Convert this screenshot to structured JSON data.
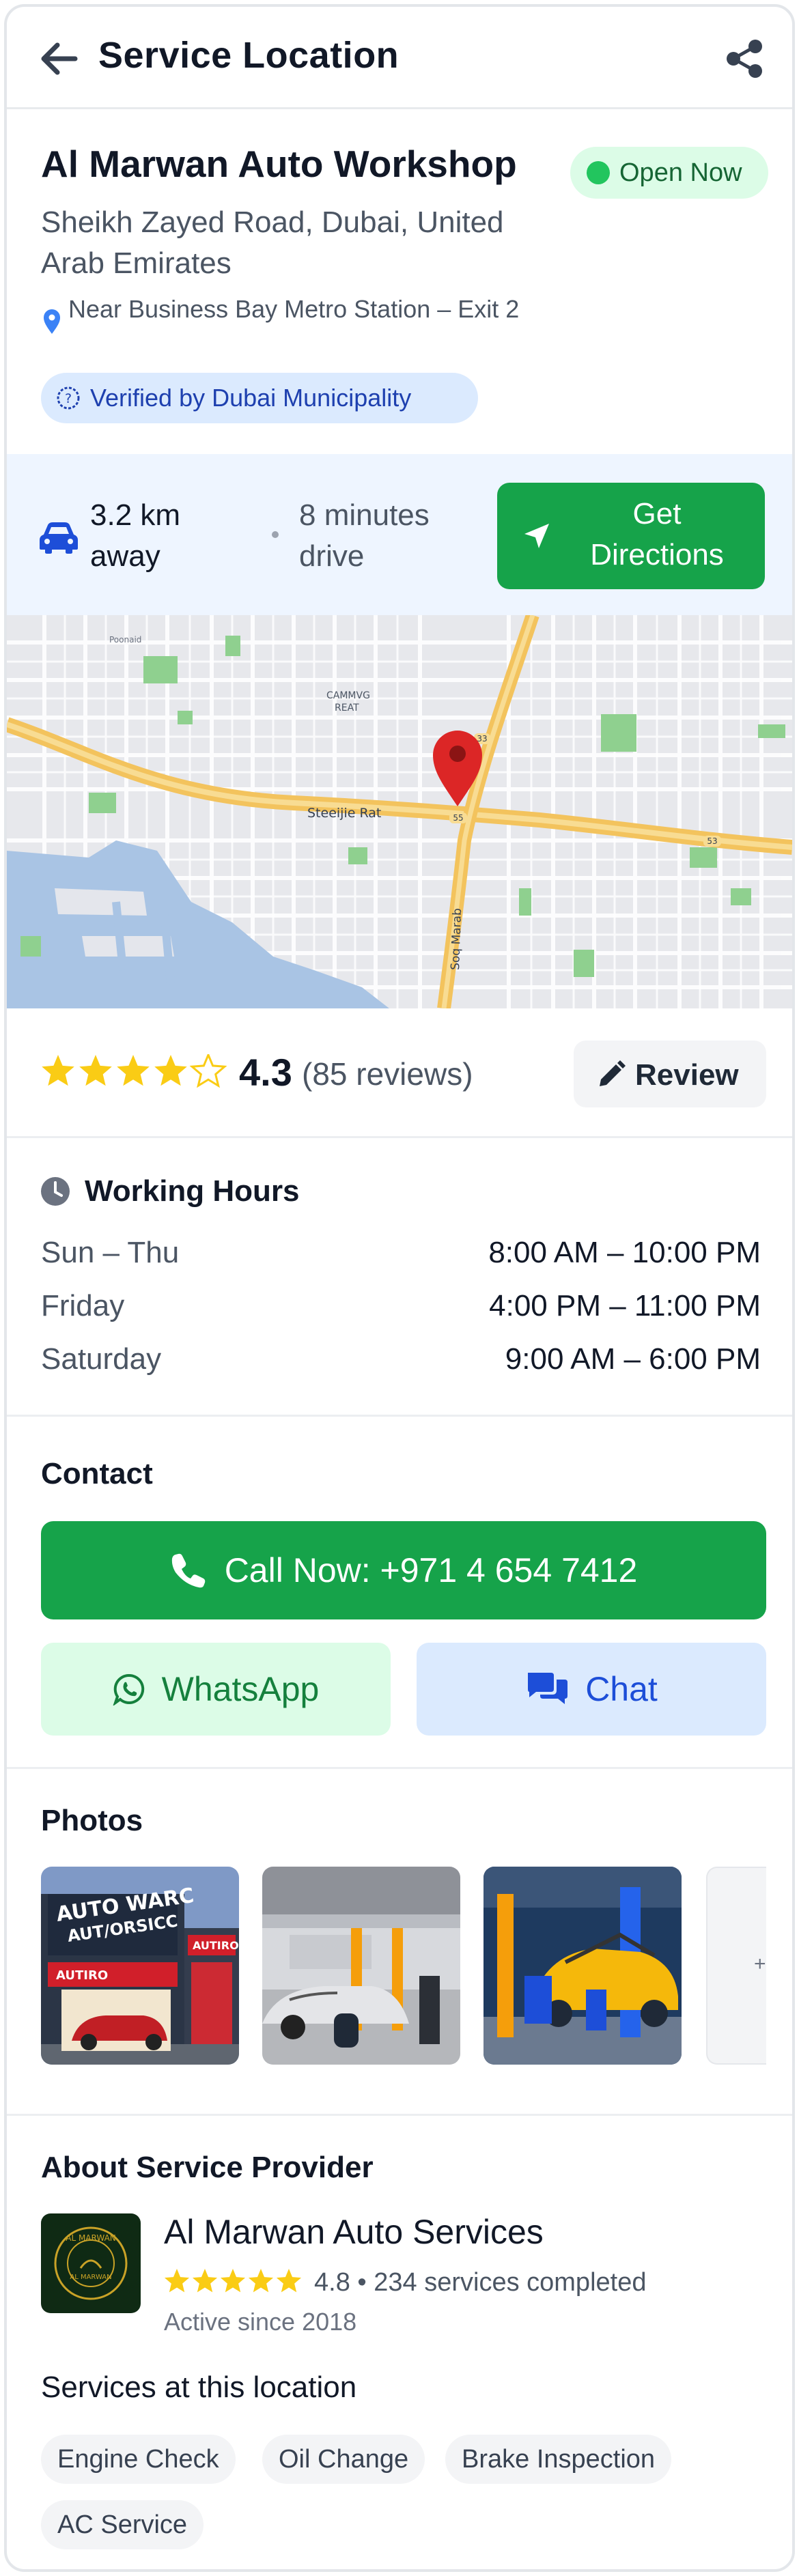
{
  "header": {
    "title": "Service Location"
  },
  "business": {
    "name": "Al Marwan Auto Workshop",
    "status": "Open Now",
    "address": "Sheikh Zayed Road, Dubai, United Arab Emirates",
    "landmark": "Near Business Bay Metro Station – Exit 2",
    "verified": "Verified by Dubai Municipality"
  },
  "distance": {
    "distance": "3.2 km away",
    "drive_time": "8 minutes drive",
    "directions_label": "Get Directions"
  },
  "map": {
    "road_label_1": "Steeijie Rat",
    "road_label_2": "Soq Marab",
    "area_label_1": "CAMMVG",
    "area_label_2": "REAT",
    "area_label_3": "Poonaid",
    "route_1": "55",
    "route_2": "33",
    "route_3": "53"
  },
  "rating": {
    "value": "4.3",
    "reviews": "(85 reviews)",
    "stars": 4.3,
    "review_button": "Review"
  },
  "hours": {
    "title": "Working Hours",
    "rows": [
      {
        "day": "Sun – Thu",
        "time": "8:00 AM – 10:00 PM"
      },
      {
        "day": "Friday",
        "time": "4:00 PM – 11:00 PM"
      },
      {
        "day": "Saturday",
        "time": "9:00 AM – 6:00 PM"
      }
    ]
  },
  "contact": {
    "title": "Contact",
    "call_label": "Call Now: +971 4 654 7412",
    "whatsapp_label": "WhatsApp",
    "chat_label": "Chat"
  },
  "photos": {
    "title": "Photos",
    "sign_line_1": "AUTO WARC",
    "sign_line_2": "AUT/ORSICC",
    "sign_small": "AUTIRO",
    "sign_small_2": "AUTIRO",
    "more": "+"
  },
  "provider": {
    "section_title": "About Service Provider",
    "name": "Al Marwan Auto Services",
    "rating": "4.8",
    "services_completed": "234 services completed",
    "meta_separator": "•",
    "active_since": "Active since 2018",
    "logo_text_top": "AL MARWAN",
    "logo_text_mid": "AL MARWAN",
    "stars": 5
  },
  "services": {
    "title": "Services at this location",
    "items": [
      "Engine Check",
      "Oil Change",
      "Brake Inspection",
      "AC Service"
    ]
  },
  "colors": {
    "primary_green": "#16a34a",
    "open_badge_bg": "#dcfce7",
    "verified_bg": "#dbeafe",
    "star": "#facc15",
    "map_pin": "#dc2626"
  },
  "icons": [
    "back-arrow-icon",
    "share-icon",
    "map-pin-icon",
    "shield-check-icon",
    "car-icon",
    "navigation-arrow-icon",
    "star-icon",
    "pencil-icon",
    "clock-icon",
    "phone-icon",
    "whatsapp-icon",
    "chat-bubbles-icon"
  ]
}
